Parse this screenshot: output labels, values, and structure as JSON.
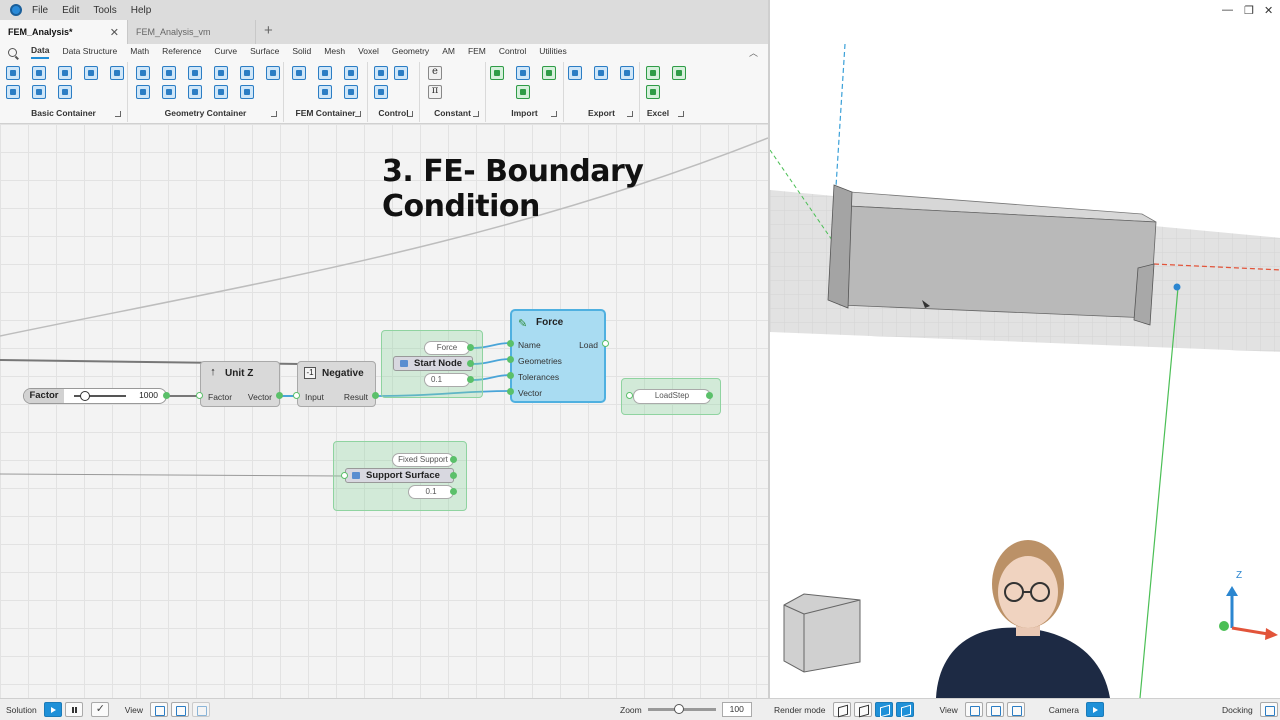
{
  "menu": [
    "File",
    "Edit",
    "Tools",
    "Help"
  ],
  "tabs": [
    {
      "label": "FEM_Analysis*",
      "active": true
    },
    {
      "label": "FEM_Analysis_vm",
      "active": false
    }
  ],
  "ribbon": {
    "categories": [
      "Data",
      "Data Structure",
      "Math",
      "Reference",
      "Curve",
      "Surface",
      "Solid",
      "Mesh",
      "Voxel",
      "Geometry",
      "AM",
      "FEM",
      "Control",
      "Utilities"
    ],
    "active_category": "Data",
    "groups": [
      "Basic Container",
      "Geometry Container",
      "FEM Container",
      "Control",
      "Constant",
      "Import",
      "Export",
      "Excel"
    ],
    "constant_glyphs": [
      "e",
      "π"
    ]
  },
  "canvas": {
    "overlay_title": "3. FE- Boundary Condition",
    "slider": {
      "label": "Factor",
      "value": "1000"
    },
    "unitz": {
      "title": "Unit Z",
      "input": "Factor",
      "output": "Vector",
      "badge": "↑"
    },
    "negative": {
      "title": "Negative",
      "input": "Input",
      "output": "Result",
      "badge": "-1"
    },
    "start_node_group": {
      "name": "Force",
      "node": "Start Node",
      "tolerance": "0.1"
    },
    "force": {
      "title": "Force",
      "inputs": [
        "Name",
        "Geometries",
        "Tolerances",
        "Vector"
      ],
      "output": "Load"
    },
    "loadstep": {
      "label": "LoadStep"
    },
    "support_group": {
      "name": "Fixed Support",
      "node": "Support Surface",
      "tolerance": "0.1"
    }
  },
  "viewport": {
    "axis_label": "Z"
  },
  "status_left": {
    "solution": "Solution",
    "view": "View",
    "zoom_label": "Zoom",
    "zoom_value": "100",
    "zoom_fraction": 0.45
  },
  "status_right": {
    "render_mode": "Render mode",
    "view": "View",
    "camera": "Camera",
    "docking": "Docking"
  },
  "colors": {
    "accent": "#1e90d8",
    "force_node": "#a9dcf2",
    "group_green": "#8fd3a0"
  }
}
